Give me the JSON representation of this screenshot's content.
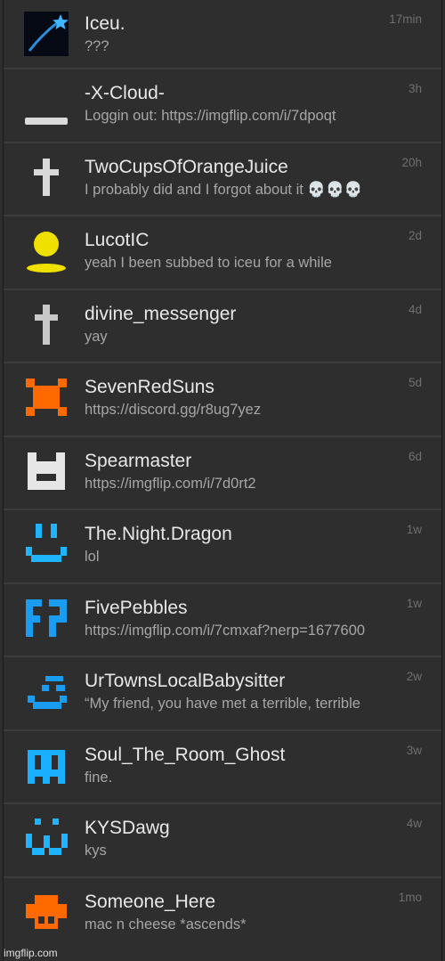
{
  "conversations": [
    {
      "name": "Iceu.",
      "message": "???",
      "time": "17min",
      "avatar_icon": "shooting-star-icon"
    },
    {
      "name": "-X-Cloud-",
      "message": "Loggin out: https://imgflip.com/i/7dpoqt",
      "time": "3h",
      "avatar_icon": "white-bar-icon"
    },
    {
      "name": "TwoCupsOfOrangeJuice",
      "message": "I probably did and I forgot about it 💀💀💀",
      "time": "20h",
      "avatar_icon": "white-cross-icon"
    },
    {
      "name": "LucotIC",
      "message": "yeah I been subbed to iceu for a while",
      "time": "2d",
      "avatar_icon": "yellow-person-icon"
    },
    {
      "name": "divine_messenger",
      "message": "yay",
      "time": "4d",
      "avatar_icon": "gray-cross-icon"
    },
    {
      "name": "SevenRedSuns",
      "message": "https://discord.gg/r8ug7yez",
      "time": "5d",
      "avatar_icon": "orange-pixel-face-icon"
    },
    {
      "name": "Spearmaster",
      "message": "https://imgflip.com/i/7d0rt2",
      "time": "6d",
      "avatar_icon": "white-pixel-face-icon"
    },
    {
      "name": "The.Night.Dragon",
      "message": "lol",
      "time": "1w",
      "avatar_icon": "cyan-smile-face-icon"
    },
    {
      "name": "FivePebbles",
      "message": "https://imgflip.com/i/7cmxaf?nerp=1677600",
      "time": "1w",
      "avatar_icon": "blue-pixel-face-icon"
    },
    {
      "name": "UrTownsLocalBabysitter",
      "message": "“My friend, you have met a terrible, terrible",
      "time": "2w",
      "avatar_icon": "blue-smirk-face-icon"
    },
    {
      "name": "Soul_The_Room_Ghost",
      "message": "fine.",
      "time": "3w",
      "avatar_icon": "blue-ghost-face-icon"
    },
    {
      "name": "KYSDawg",
      "message": "kys",
      "time": "4w",
      "avatar_icon": "cyan-w-face-icon"
    },
    {
      "name": "Someone_Here",
      "message": "mac n cheese *ascends*",
      "time": "1mo",
      "avatar_icon": "orange-pixel-face-icon"
    }
  ],
  "watermark": "imgflip.com",
  "colors": {
    "background": "#2e2e2e",
    "divider": "#3c3c3c",
    "name": "#e8e8e8",
    "message": "#a6a6a6",
    "time": "#6f6f6f"
  }
}
